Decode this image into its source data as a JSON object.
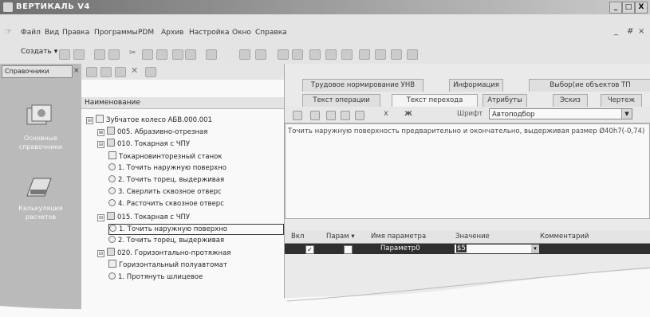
{
  "window": {
    "title": "ВЕРТИКАЛЬ V4",
    "controls": [
      "_",
      "□",
      "X"
    ]
  },
  "menu": [
    "Файл",
    "Вид",
    "Правка",
    "Программы",
    "PDM",
    "Архив",
    "Настройка",
    "Окно",
    "Справка"
  ],
  "mdi_controls": [
    "_",
    "#",
    "×"
  ],
  "toolbar": {
    "create_label": "Создать ▾"
  },
  "left_panel": {
    "header": "Справочники",
    "items": [
      {
        "label": "Основные справочники",
        "icon": "handbook-icon"
      },
      {
        "label": "Калькуляция расчетов",
        "icon": "calculator-icon"
      }
    ]
  },
  "tree": {
    "column_header": "Наименование",
    "rows": [
      {
        "text": "Зубчатое колесо АБВ.000.001",
        "level": 0,
        "kind": "part",
        "expander": "⊟"
      },
      {
        "text": "005. Абразивно-отрезная",
        "level": 1,
        "kind": "operation",
        "expander": "⊞"
      },
      {
        "text": "010. Токарная с ЧПУ",
        "level": 1,
        "kind": "operation",
        "expander": "⊟"
      },
      {
        "text": "Токарновинторезный станок",
        "level": 2,
        "kind": "equipment"
      },
      {
        "text": "1. Точить наружную поверхно",
        "level": 2,
        "kind": "step"
      },
      {
        "text": "2. Точить торец, выдерживая",
        "level": 2,
        "kind": "step"
      },
      {
        "text": "3. Сверлить сквозное отверс",
        "level": 2,
        "kind": "step"
      },
      {
        "text": "4. Расточить сквозное отверс",
        "level": 2,
        "kind": "step"
      },
      {
        "text": "015. Токарная с ЧПУ",
        "level": 1,
        "kind": "operation",
        "expander": "⊟"
      },
      {
        "text": "1. Точить наружную поверхно",
        "level": 2,
        "kind": "step",
        "selected": true
      },
      {
        "text": "2. Точить торец, выдерживая",
        "level": 2,
        "kind": "step"
      },
      {
        "text": "020. Горизонтально-протяжная",
        "level": 1,
        "kind": "operation",
        "expander": "⊟"
      },
      {
        "text": "Горизонтальный полуавтомат",
        "level": 2,
        "kind": "equipment"
      },
      {
        "text": "1. Протянуть шлицевое",
        "level": 2,
        "kind": "step"
      }
    ]
  },
  "top_tabs": [
    "Трудовое нормирование УНВ",
    "Информация",
    "Выбор(ие объектов ТП"
  ],
  "sub_tabs": [
    "Текст операции",
    "Текст перехода",
    "Атрибуты",
    "Эскиз",
    "Чертеж"
  ],
  "format_bar": {
    "font_label": "Шрифт",
    "font_value": "Автоподбор"
  },
  "editor": {
    "text": "Точить наружную поверхность предварительно и окончательно, выдерживая размер Ø40h7(-0,74)"
  },
  "params_table": {
    "headers": [
      "Вкл",
      "Парам ▾",
      "Имя параметра",
      "Значение",
      "Комментарий"
    ],
    "rows": [
      {
        "enabled": true,
        "param": false,
        "name": "Параметр0",
        "value": "$5",
        "comment": ""
      }
    ]
  },
  "colors": {
    "titlebar": "#8a8a8a",
    "left_panel": "#bdbdbd",
    "selected_row": "#2b2b2b"
  }
}
